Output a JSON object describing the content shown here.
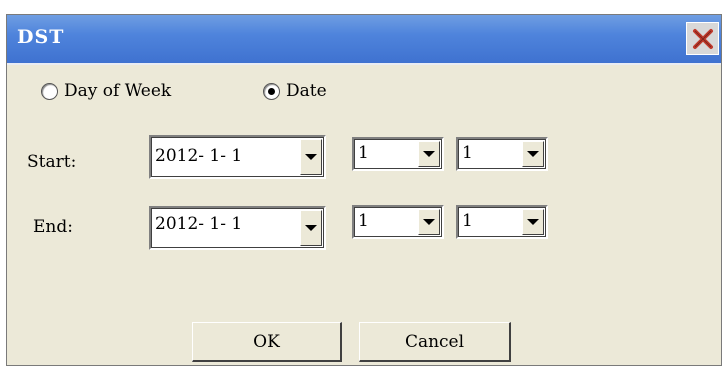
{
  "window": {
    "title": "DST"
  },
  "mode": {
    "options": [
      {
        "label": "Day of Week",
        "selected": false
      },
      {
        "label": "Date",
        "selected": true
      }
    ]
  },
  "start": {
    "label": "Start:",
    "date": "2012- 1- 1",
    "hour": "1",
    "minute": "1"
  },
  "end": {
    "label": "End:",
    "date": "2012- 1- 1",
    "hour": "1",
    "minute": "1"
  },
  "buttons": {
    "ok": "OK",
    "cancel": "Cancel"
  },
  "colors": {
    "titlebar": "#4f84dc",
    "dialog_bg": "#ece9d8",
    "close_x": "#d21f1f"
  }
}
